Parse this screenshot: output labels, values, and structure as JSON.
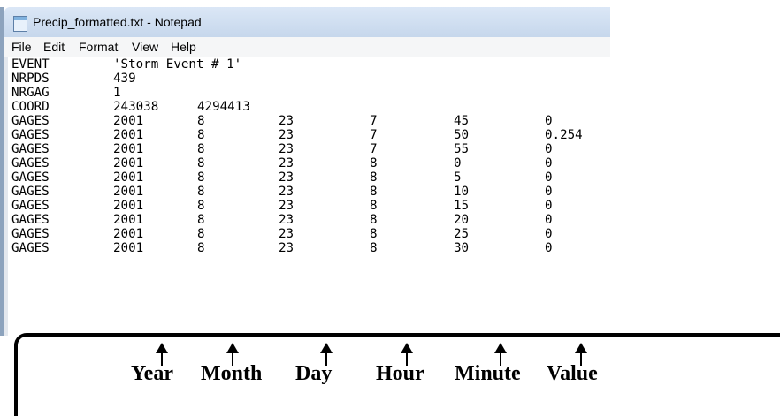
{
  "window": {
    "title": "Precip_formatted.txt - Notepad"
  },
  "menu": [
    "File",
    "Edit",
    "Format",
    "View",
    "Help"
  ],
  "lines": [
    {
      "key": "EVENT",
      "cols": [
        "'Storm Event # 1'"
      ]
    },
    {
      "key": "NRPDS",
      "cols": [
        "439"
      ]
    },
    {
      "key": "NRGAG",
      "cols": [
        "1"
      ]
    },
    {
      "key": "COORD",
      "cols": [
        "243038",
        "4294413"
      ]
    },
    {
      "key": "GAGES",
      "cols": [
        "2001",
        "8",
        "23",
        "7",
        "45",
        "0"
      ]
    },
    {
      "key": "GAGES",
      "cols": [
        "2001",
        "8",
        "23",
        "7",
        "50",
        "0.254"
      ]
    },
    {
      "key": "GAGES",
      "cols": [
        "2001",
        "8",
        "23",
        "7",
        "55",
        "0"
      ]
    },
    {
      "key": "GAGES",
      "cols": [
        "2001",
        "8",
        "23",
        "8",
        "0",
        "0"
      ]
    },
    {
      "key": "GAGES",
      "cols": [
        "2001",
        "8",
        "23",
        "8",
        "5",
        "0"
      ]
    },
    {
      "key": "GAGES",
      "cols": [
        "2001",
        "8",
        "23",
        "8",
        "10",
        "0"
      ]
    },
    {
      "key": "GAGES",
      "cols": [
        "2001",
        "8",
        "23",
        "8",
        "15",
        "0"
      ]
    },
    {
      "key": "GAGES",
      "cols": [
        "2001",
        "8",
        "23",
        "8",
        "20",
        "0"
      ]
    },
    {
      "key": "GAGES",
      "cols": [
        "2001",
        "8",
        "23",
        "8",
        "25",
        "0"
      ]
    },
    {
      "key": "GAGES",
      "cols": [
        "2001",
        "8",
        "23",
        "8",
        "30",
        "0"
      ]
    }
  ],
  "annotations": [
    "Year",
    "Month",
    "Day",
    "Hour",
    "Minute",
    "Value"
  ]
}
